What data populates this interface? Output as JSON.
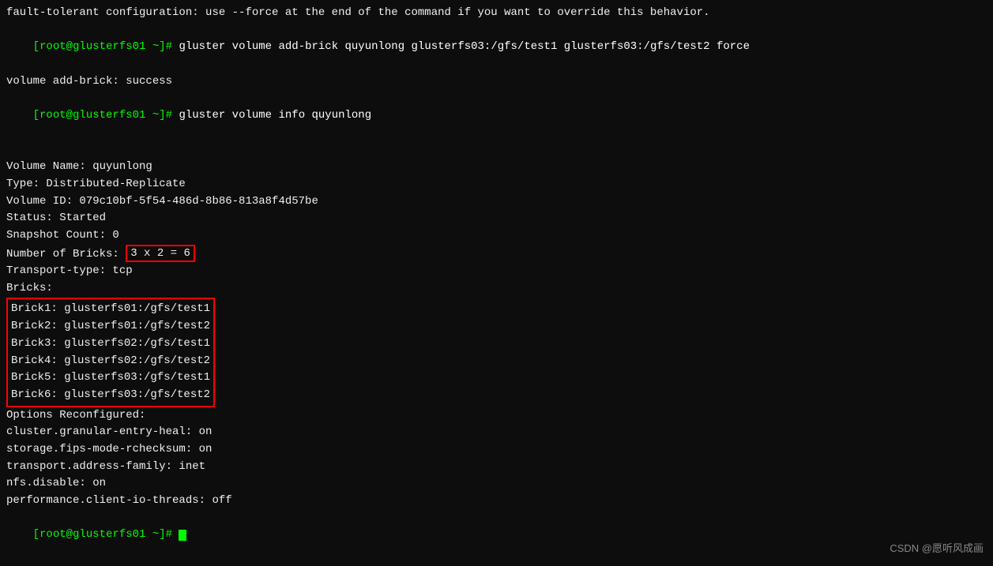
{
  "terminal": {
    "lines": [
      {
        "type": "truncated_top",
        "text": "fault-tolerant configuration: use --force at the end of the command if you want to override this behavior."
      },
      {
        "type": "prompt_cmd",
        "prompt": "[root@glusterfs01 ~]#",
        "cmd": " gluster volume add-brick quyunlong glusterfs03:/gfs/test1 glusterfs03:/gfs/test2 force"
      },
      {
        "type": "plain",
        "text": "volume add-brick: success"
      },
      {
        "type": "prompt_cmd",
        "prompt": "[root@glusterfs01 ~]#",
        "cmd": " gluster volume info quyunlong"
      },
      {
        "type": "blank"
      },
      {
        "type": "plain",
        "text": "Volume Name: quyunlong"
      },
      {
        "type": "plain",
        "text": "Type: Distributed-Replicate"
      },
      {
        "type": "plain",
        "text": "Volume ID: 079c10bf-5f54-486d-8b86-813a8f4d57be"
      },
      {
        "type": "plain",
        "text": "Status: Started"
      },
      {
        "type": "plain",
        "text": "Snapshot Count: 0"
      },
      {
        "type": "number_of_bricks",
        "prefix": "Number of Bricks: ",
        "highlighted": "3 x 2 = 6"
      },
      {
        "type": "plain",
        "text": "Transport-type: tcp"
      },
      {
        "type": "plain",
        "text": "Bricks:"
      },
      {
        "type": "brick",
        "text": "Brick1: glusterfs01:/gfs/test1"
      },
      {
        "type": "brick",
        "text": "Brick2: glusterfs01:/gfs/test2"
      },
      {
        "type": "brick",
        "text": "Brick3: glusterfs02:/gfs/test1"
      },
      {
        "type": "brick",
        "text": "Brick4: glusterfs02:/gfs/test2"
      },
      {
        "type": "brick",
        "text": "Brick5: glusterfs03:/gfs/test1"
      },
      {
        "type": "brick",
        "text": "Brick6: glusterfs03:/gfs/test2"
      },
      {
        "type": "plain",
        "text": "Options Reconfigured:"
      },
      {
        "type": "plain",
        "text": "cluster.granular-entry-heal: on"
      },
      {
        "type": "plain",
        "text": "storage.fips-mode-rchecksum: on"
      },
      {
        "type": "plain",
        "text": "transport.address-family: inet"
      },
      {
        "type": "plain",
        "text": "nfs.disable: on"
      },
      {
        "type": "plain",
        "text": "performance.client-io-threads: off"
      },
      {
        "type": "prompt_cursor",
        "prompt": "[root@glusterfs01 ~]#"
      }
    ],
    "watermark": "CSDN @愿听风成画"
  }
}
